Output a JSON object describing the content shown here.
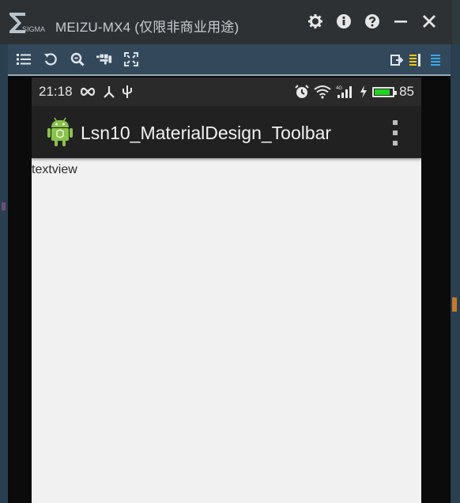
{
  "window": {
    "title": "MEIZU-MX4 (仅限非商业用途)",
    "logo_text": "SIGMA",
    "title_icons": [
      "gear-icon",
      "info-icon",
      "help-icon",
      "minimize-icon",
      "close-icon"
    ]
  },
  "toolbar": {
    "left_icons": [
      "list-icon",
      "rotate-icon",
      "zoom-icon",
      "keyboard-icon",
      "fullscreen-icon"
    ],
    "right_icons": [
      "export-icon",
      "align-left-icon",
      "align-right-icon"
    ]
  },
  "statusbar": {
    "time": "21:18",
    "battery_level": "85",
    "battery_fraction": 0.85
  },
  "appbar": {
    "title": "Lsn10_MaterialDesign_Toolbar"
  },
  "content": {
    "textview": "textview"
  },
  "colors": {
    "titlebar": "#2e3133",
    "toolbar": "#33495b",
    "appbar": "#212121",
    "statusbar": "#2a2a2a",
    "content_bg": "#f1f1f1",
    "battery": "#1fd41f",
    "android_green": "#8bc34a"
  }
}
